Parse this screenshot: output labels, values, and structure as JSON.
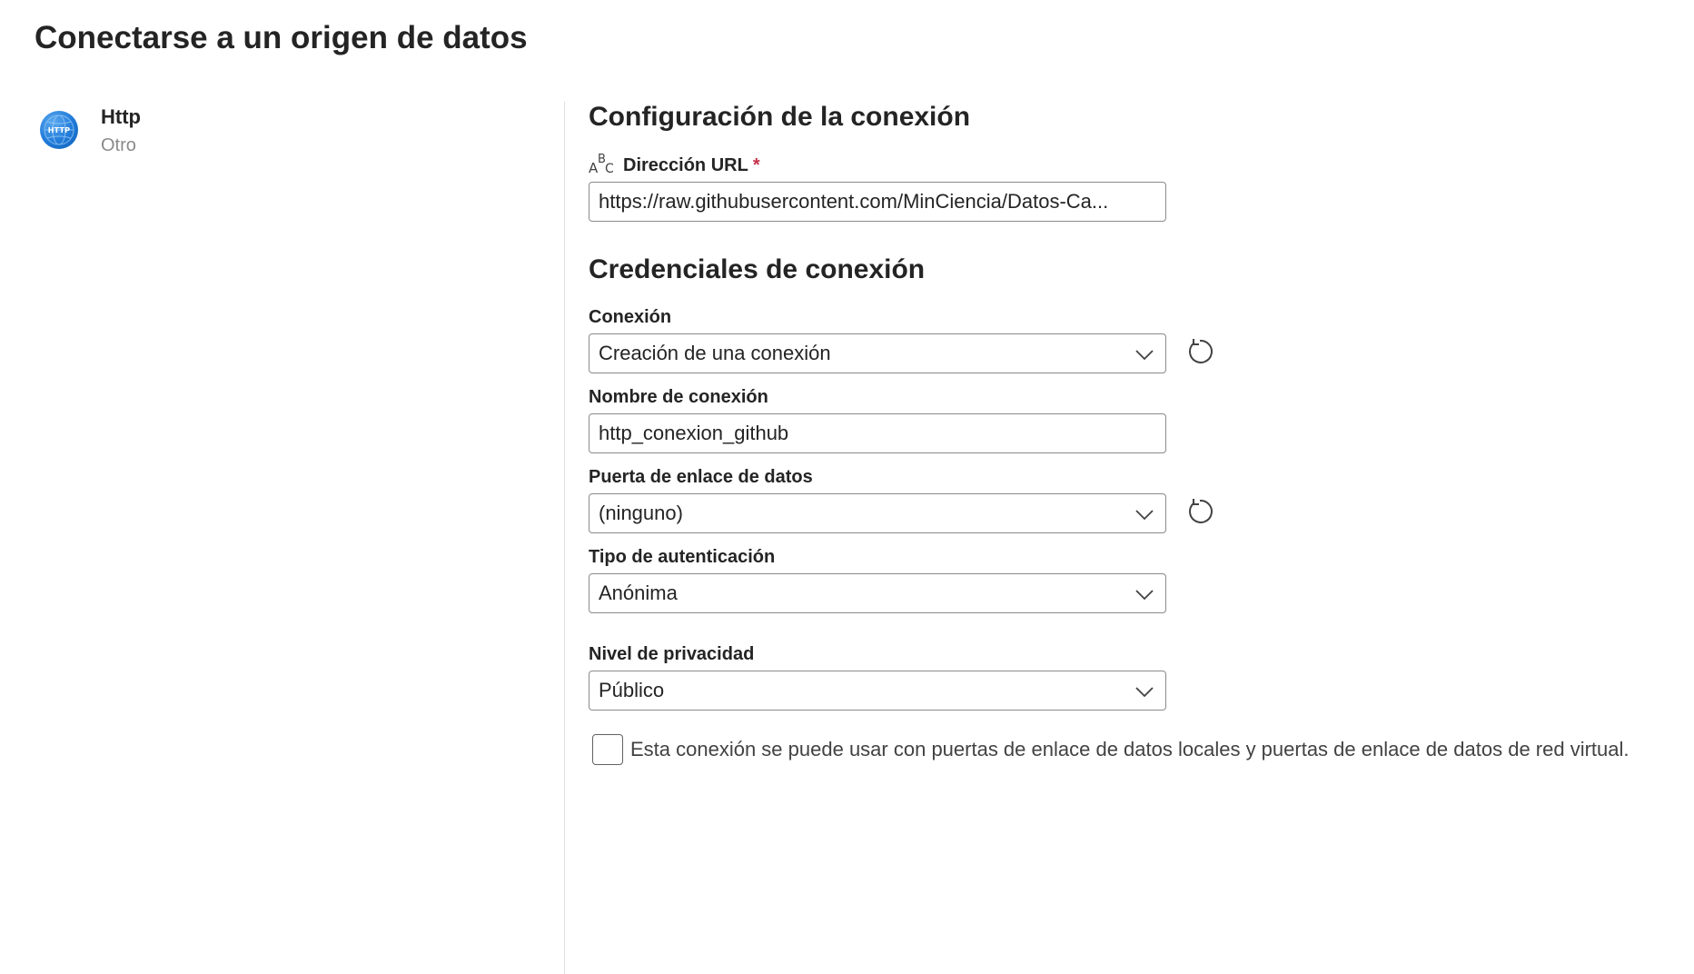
{
  "page": {
    "title": "Conectarse a un origen de datos"
  },
  "connector": {
    "name": "Http",
    "category": "Otro",
    "logo_text": "HTTP",
    "logo_icon": "globe-icon"
  },
  "connection_settings": {
    "title": "Configuración de la conexión",
    "url_label": "Dirección URL",
    "url_label_icon": "abc-text-icon",
    "required_marker": "*",
    "url_value": "https://raw.githubusercontent.com/MinCiencia/Datos-Ca..."
  },
  "credentials": {
    "title": "Credenciales de conexión",
    "connection_label": "Conexión",
    "connection_value": "Creación de una conexión",
    "connection_name_label": "Nombre de conexión",
    "connection_name_value": "http_conexion_github",
    "gateway_label": "Puerta de enlace de datos",
    "gateway_value": "(ninguno)",
    "auth_type_label": "Tipo de autenticación",
    "auth_type_value": "Anónima",
    "privacy_label": "Nivel de privacidad",
    "privacy_value": "Público",
    "gateway_checkbox_label": "Esta conexión se puede usar con puertas de enlace de datos locales y puertas de enlace de datos de red virtual.",
    "gateway_checkbox_checked": false
  },
  "icons": {
    "dropdown": "chevron-down-icon",
    "refresh": "refresh-icon"
  },
  "colors": {
    "required": "#c4314b",
    "logo_blue": "#1f7ad8",
    "border": "#8a8a8a",
    "muted_text": "#8a8a8a"
  }
}
